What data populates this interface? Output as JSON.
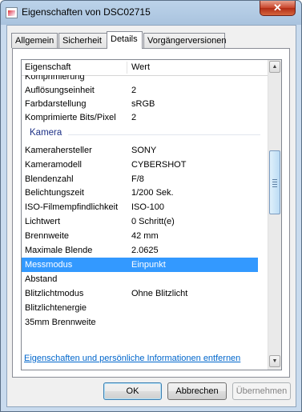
{
  "window": {
    "title": "Eigenschaften von DSC02715",
    "close_glyph": "✕",
    "app_icon": "image-file-icon"
  },
  "tabs": [
    {
      "label": "Allgemein",
      "active": false
    },
    {
      "label": "Sicherheit",
      "active": false
    },
    {
      "label": "Details",
      "active": true
    },
    {
      "label": "Vorgängerversionen",
      "active": false
    }
  ],
  "list": {
    "columns": {
      "property": "Eigenschaft",
      "value": "Wert"
    },
    "rows_before": [
      {
        "name": "Komprimierung",
        "value": ""
      },
      {
        "name": "Auflösungseinheit",
        "value": "2"
      },
      {
        "name": "Farbdarstellung",
        "value": "sRGB"
      },
      {
        "name": "Komprimierte Bits/Pixel",
        "value": "2"
      }
    ],
    "group_label": "Kamera",
    "rows_after": [
      {
        "name": "Kamerahersteller",
        "value": "SONY"
      },
      {
        "name": "Kameramodell",
        "value": "CYBERSHOT"
      },
      {
        "name": "Blendenzahl",
        "value": "F/8"
      },
      {
        "name": "Belichtungszeit",
        "value": "1/200 Sek."
      },
      {
        "name": "ISO-Filmempfindlichkeit",
        "value": "ISO-100"
      },
      {
        "name": "Lichtwert",
        "value": "0 Schritt(e)"
      },
      {
        "name": "Brennweite",
        "value": "42 mm"
      },
      {
        "name": "Maximale Blende",
        "value": "2.0625"
      },
      {
        "name": "Messmodus",
        "value": "Einpunkt",
        "selected": true
      },
      {
        "name": "Abstand",
        "value": ""
      },
      {
        "name": "Blitzlichtmodus",
        "value": "Ohne Blitzlicht"
      },
      {
        "name": "Blitzlichtenergie",
        "value": ""
      },
      {
        "name": "35mm Brennweite",
        "value": ""
      }
    ],
    "scroll_up_glyph": "▲",
    "scroll_down_glyph": "▼"
  },
  "remove_link": "Eigenschaften und persönliche Informationen entfernen",
  "buttons": {
    "ok": "OK",
    "cancel": "Abbrechen",
    "apply": "Übernehmen"
  },
  "colors": {
    "selection": "#3399ff",
    "link": "#0066cc",
    "group_label": "#1e3287"
  }
}
